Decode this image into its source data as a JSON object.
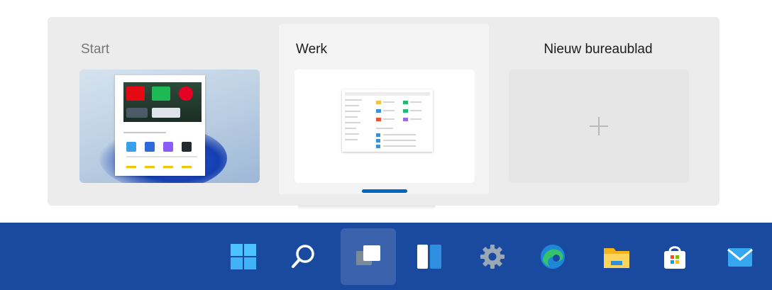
{
  "desktops": [
    {
      "name": "Start"
    },
    {
      "name": "Werk"
    },
    {
      "name": "Nieuw bureaublad"
    }
  ],
  "colors": {
    "taskbar": "#1a4aa0",
    "accent": "#0067c0",
    "flyout": "#ececec"
  },
  "taskbar": {
    "icons": [
      "windows-start-icon",
      "search-icon",
      "task-view-icon",
      "widgets-icon",
      "settings-icon",
      "edge-icon",
      "file-explorer-icon",
      "microsoft-store-icon",
      "mail-icon"
    ],
    "active_icon": "task-view-icon"
  }
}
